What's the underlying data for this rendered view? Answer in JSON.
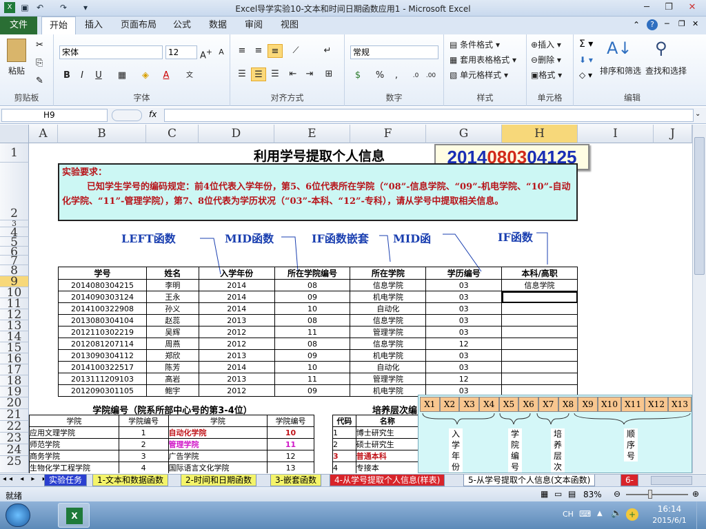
{
  "window": {
    "title": "Excel导学实验10-文本和时间日期函数应用1  -  Microsoft Excel"
  },
  "ribbon_tabs": [
    "文件",
    "开始",
    "插入",
    "页面布局",
    "公式",
    "数据",
    "审阅",
    "视图"
  ],
  "clipboard": {
    "paste": "粘贴",
    "group": "剪贴板"
  },
  "font": {
    "name": "宋体",
    "size": "12",
    "group": "字体",
    "bold": "B",
    "italic": "I",
    "underline": "U"
  },
  "align": {
    "group": "对齐方式"
  },
  "number": {
    "format": "常规",
    "percent": "%",
    "comma": ",",
    "group": "数字"
  },
  "styles": {
    "cond": "条件格式",
    "table": "套用表格格式",
    "cell": "单元格样式",
    "group": "样式"
  },
  "cells": {
    "insert": "插入",
    "delete": "删除",
    "format": "格式",
    "group": "单元格"
  },
  "editing": {
    "sort": "排序和筛选",
    "find": "查找和选择",
    "group": "编辑"
  },
  "formula_bar": {
    "name_box": "H9",
    "fx": "fx",
    "value": ""
  },
  "columns": [
    "A",
    "B",
    "C",
    "D",
    "E",
    "F",
    "G",
    "H",
    "I",
    "J"
  ],
  "rows": [
    "1",
    "2",
    "3",
    "4",
    "5",
    "6",
    "7",
    "8",
    "9",
    "10",
    "11",
    "12",
    "13",
    "14",
    "15",
    "16",
    "17",
    "18",
    "19",
    "20",
    "21",
    "22",
    "23",
    "24",
    "25"
  ],
  "sheet": {
    "title": "利用学号提取个人信息",
    "id_parts": [
      "2014",
      "08",
      "03",
      "04125"
    ],
    "id_colors": [
      "#1a2fb5",
      "#d12a1a",
      "#1a2fb5",
      "#1a2fb5"
    ],
    "req_head": "实验要求：",
    "req_body": "已知学生学号的编码规定：前4位代表入学年份，第5、6位代表所在学院（“08”-信息学院、“09”-机电学院、“10”-自动化学院、“11”-管理学院），第7、8位代表为学历状况（“03”-本科、“12”-专科），请从学号中提取相关信息。",
    "labels": [
      "LEFT函数",
      "MID函数",
      "IF函数嵌套",
      "MID函",
      "IF函数"
    ],
    "headers": [
      "学号",
      "姓名",
      "入学年份",
      "所在学院编号",
      "所在学院",
      "学历编号",
      "本科/高职"
    ],
    "rows": [
      [
        "2014080304215",
        "李明",
        "2014",
        "08",
        "信息学院",
        "03",
        "信息学院"
      ],
      [
        "2014090303124",
        "王永",
        "2014",
        "09",
        "机电学院",
        "03",
        ""
      ],
      [
        "2014100322908",
        "孙义",
        "2014",
        "10",
        "自动化",
        "03",
        ""
      ],
      [
        "2013080304104",
        "赵蕊",
        "2013",
        "08",
        "信息学院",
        "03",
        ""
      ],
      [
        "2012110302219",
        "吴辉",
        "2012",
        "11",
        "管理学院",
        "03",
        ""
      ],
      [
        "2012081207114",
        "周燕",
        "2012",
        "08",
        "信息学院",
        "12",
        ""
      ],
      [
        "2013090304112",
        "郑欣",
        "2013",
        "09",
        "机电学院",
        "03",
        ""
      ],
      [
        "2014100322517",
        "陈芳",
        "2014",
        "10",
        "自动化",
        "03",
        ""
      ],
      [
        "2013111209103",
        "高岩",
        "2013",
        "11",
        "管理学院",
        "12",
        ""
      ],
      [
        "2012090301105",
        "鲍宇",
        "2012",
        "09",
        "机电学院",
        "03",
        ""
      ]
    ],
    "college_title": "学院编号（院系所部中心号的第3-4位）",
    "college_headers": [
      "学院",
      "学院编号",
      "学院",
      "学院编号"
    ],
    "college_rows": [
      [
        "应用文理学院",
        "1",
        "自动化学院",
        "10"
      ],
      [
        "师范学院",
        "2",
        "管理学院",
        "11"
      ],
      [
        "商务学院",
        "3",
        "广告学院",
        "12"
      ],
      [
        "生物化学工程学院",
        "4",
        "国际语言文化学院",
        "13"
      ]
    ],
    "level_title": "培养层次编",
    "level_headers": [
      "代码",
      "名称"
    ],
    "level_rows": [
      [
        "1",
        "博士研究生"
      ],
      [
        "2",
        "硕士研究生"
      ],
      [
        "3",
        "普通本科"
      ],
      [
        "4",
        "专接本"
      ]
    ],
    "diagram_boxes": [
      "X1",
      "X2",
      "X3",
      "X4",
      "X5",
      "X6",
      "X7",
      "X8",
      "X9",
      "X10",
      "X11",
      "X12",
      "X13"
    ],
    "diagram_labels": [
      "入学年份",
      "学院编号",
      "培养层次",
      "顺序号"
    ]
  },
  "sheet_tabs": [
    "实验任务",
    "1-文本和数据函数",
    "2-时间和日期函数",
    "3-嵌套函数",
    "4-从学号提取个人信息(样表)",
    "5-从学号提取个人信息(文本函数)",
    "6-"
  ],
  "status": {
    "ready": "就绪",
    "zoom": "83%"
  },
  "taskbar": {
    "lang": "CH",
    "time": "16:14",
    "date": "2015/6/1"
  }
}
